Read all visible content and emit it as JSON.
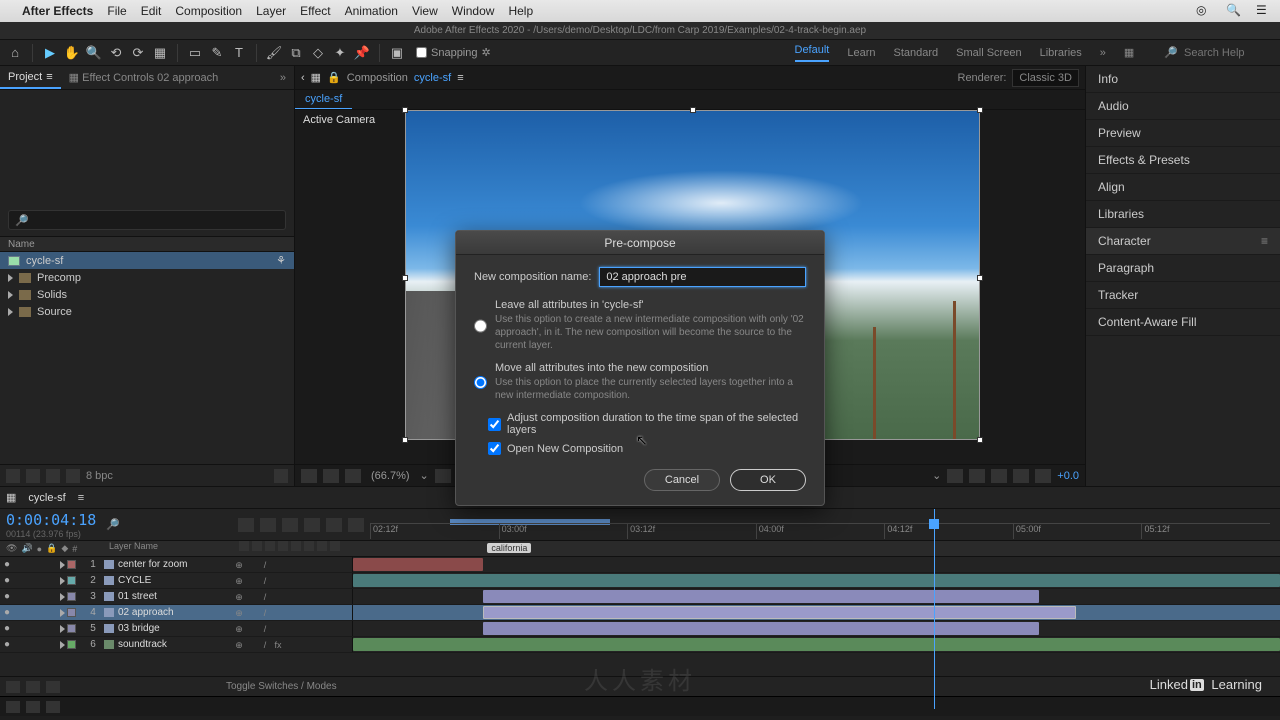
{
  "os_menu": {
    "app": "After Effects",
    "items": [
      "File",
      "Edit",
      "Composition",
      "Layer",
      "Effect",
      "Animation",
      "View",
      "Window",
      "Help"
    ]
  },
  "titlebar": "Adobe After Effects 2020 - /Users/demo/Desktop/LDC/from Carp 2019/Examples/02-4-track-begin.aep",
  "toolbar": {
    "snapping_label": "Snapping"
  },
  "workspaces": {
    "items": [
      "Default",
      "Learn",
      "Standard",
      "Small Screen",
      "Libraries"
    ],
    "active": "Default",
    "search_placeholder": "Search Help"
  },
  "left_panel": {
    "tabs": {
      "project": "Project",
      "effect_controls": "Effect Controls 02 approach"
    },
    "header_name": "Name",
    "items": [
      {
        "name": "cycle-sf",
        "type": "comp",
        "selected": true
      },
      {
        "name": "Precomp",
        "type": "folder"
      },
      {
        "name": "Solids",
        "type": "folder"
      },
      {
        "name": "Source",
        "type": "folder"
      }
    ],
    "footer_bpc": "8 bpc"
  },
  "comp_panel": {
    "prefix": "Composition",
    "name": "cycle-sf",
    "subtab": "cycle-sf",
    "active_camera": "Active Camera",
    "renderer_label": "Renderer:",
    "renderer_value": "Classic 3D",
    "zoom": "(66.7%)",
    "exposure": "+0.0"
  },
  "right_panels": [
    "Info",
    "Audio",
    "Preview",
    "Effects & Presets",
    "Align",
    "Libraries",
    "Character",
    "Paragraph",
    "Tracker",
    "Content-Aware Fill"
  ],
  "right_active": "Character",
  "timeline": {
    "tab": "cycle-sf",
    "timecode": "0:00:04:18",
    "timecode_sub": "00114 (23.976 fps)",
    "col_layername": "Layer Name",
    "ruler": [
      "02:12f",
      "03:00f",
      "03:12f",
      "04:00f",
      "04:12f",
      "05:00f",
      "05:12f"
    ],
    "marker": "california",
    "layers": [
      {
        "n": 1,
        "name": "center for zoom",
        "sel": false,
        "ico": "solid",
        "bar": "red"
      },
      {
        "n": 2,
        "name": "CYCLE",
        "sel": false,
        "ico": "text",
        "bar": "teal"
      },
      {
        "n": 3,
        "name": "01 street",
        "sel": false,
        "ico": "comp",
        "bar": "lav"
      },
      {
        "n": 4,
        "name": "02 approach",
        "sel": true,
        "ico": "comp",
        "bar": "lav2"
      },
      {
        "n": 5,
        "name": "03 bridge",
        "sel": false,
        "ico": "comp",
        "bar": "lav"
      },
      {
        "n": 6,
        "name": "soundtrack",
        "sel": false,
        "ico": "snd",
        "bar": "grn"
      }
    ],
    "footer_toggle": "Toggle Switches / Modes"
  },
  "modal": {
    "title": "Pre-compose",
    "name_label": "New composition name:",
    "name_value": "02 approach pre",
    "opt1_head": "Leave all attributes in 'cycle-sf'",
    "opt1_desc": "Use this option to create a new intermediate composition with only '02 approach', in it. The new composition will become the source to the current layer.",
    "opt2_head": "Move all attributes into the new composition",
    "opt2_desc": "Use this option to place the currently selected layers together into a new intermediate composition.",
    "chk1": "Adjust composition duration to the time span of the selected layers",
    "chk2": "Open New Composition",
    "cancel": "Cancel",
    "ok": "OK"
  },
  "branding": {
    "linkedin": "Linked",
    "in": "in",
    "learning": "Learning"
  }
}
